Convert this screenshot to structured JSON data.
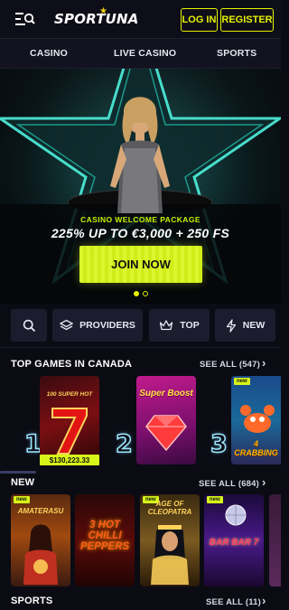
{
  "header": {
    "logo": "SPORTUNA",
    "login_label": "LOG IN",
    "register_label": "REGISTER"
  },
  "nav": {
    "items": [
      "CASINO",
      "LIVE CASINO",
      "SPORTS"
    ]
  },
  "hero": {
    "kicker": "CASINO WELCOME PACKAGE",
    "title": "225% UP TO €3,000 + 250 FS",
    "cta": "JOIN NOW",
    "slides_total": 2,
    "active_slide": 1
  },
  "filters": {
    "providers": "PROVIDERS",
    "top": "TOP",
    "new": "NEW"
  },
  "top_games": {
    "title": "TOP GAMES IN CANADA",
    "see_all": "SEE ALL (547)",
    "items": [
      {
        "rank": "1",
        "name": "100 SUPER HOT",
        "jackpot": "$130,223.33"
      },
      {
        "rank": "2",
        "name": "Super Boost",
        "badge": ""
      },
      {
        "rank": "3",
        "name": "4 CRABBING",
        "badge": "new"
      }
    ]
  },
  "new_games": {
    "title": "NEW",
    "see_all": "SEE ALL (684)",
    "items": [
      {
        "name": "AMATERASU",
        "badge": "new"
      },
      {
        "name": "3 HOT CHILLI PEPPERS",
        "badge": ""
      },
      {
        "name": "AGE OF CLEOPATRA",
        "badge": "new"
      },
      {
        "name": "BAR BAR 7",
        "badge": "new"
      }
    ]
  },
  "sports": {
    "title": "SPORTS",
    "see_all": "SEE ALL (11)"
  },
  "colors": {
    "accent": "#e6f100",
    "background": "#0b0b14",
    "panel": "#1b1c2e"
  }
}
